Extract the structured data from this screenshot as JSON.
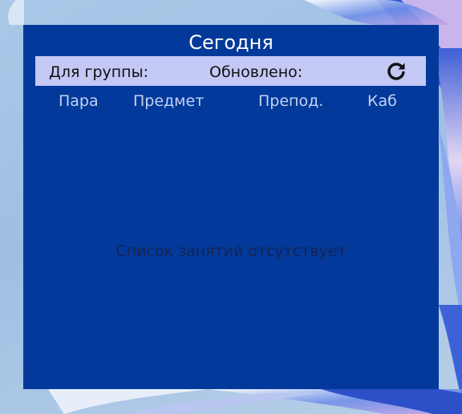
{
  "widget": {
    "title": "Сегодня",
    "group_label": "Для группы:",
    "updated_label": "Обновлено:",
    "refresh_icon": "refresh-icon",
    "columns": [
      "Пара",
      "Предмет",
      "Препод.",
      "Каб"
    ],
    "empty_message": "Список занятий отсутствует",
    "colors": {
      "background": "#02399b",
      "info_bar": "#c3c8f5",
      "title_text": "#ffffff",
      "header_text": "#c5d2f3"
    }
  }
}
